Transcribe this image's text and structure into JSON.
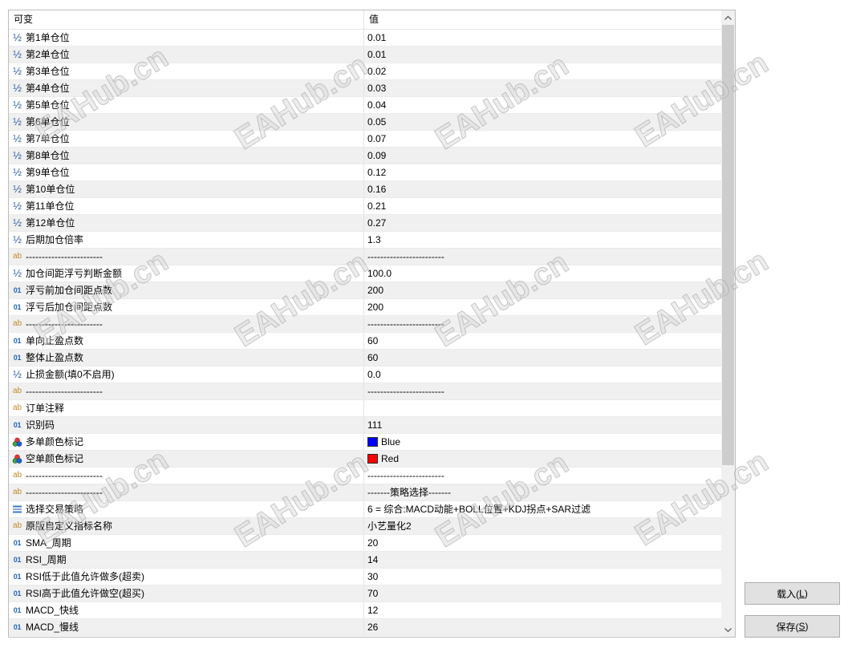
{
  "header": {
    "name_col": "可变",
    "value_col": "值"
  },
  "icons": {
    "double-param-icon": {
      "glyph": "½",
      "color": "#2f5f9f"
    },
    "string-param-icon": {
      "glyph": "ab",
      "color": "#c08a2c"
    },
    "integer-param-icon": {
      "glyph": "01",
      "color": "#2466b4"
    },
    "color-param-icon": {},
    "enum-param-icon": {}
  },
  "rows": [
    {
      "icon": "double-param-icon",
      "name": "第1单仓位",
      "value": "0.01"
    },
    {
      "icon": "double-param-icon",
      "name": "第2单仓位",
      "value": "0.01"
    },
    {
      "icon": "double-param-icon",
      "name": "第3单仓位",
      "value": "0.02"
    },
    {
      "icon": "double-param-icon",
      "name": "第4单仓位",
      "value": "0.03"
    },
    {
      "icon": "double-param-icon",
      "name": "第5单仓位",
      "value": "0.04"
    },
    {
      "icon": "double-param-icon",
      "name": "第6单仓位",
      "value": "0.05"
    },
    {
      "icon": "double-param-icon",
      "name": "第7单仓位",
      "value": "0.07"
    },
    {
      "icon": "double-param-icon",
      "name": "第8单仓位",
      "value": "0.09"
    },
    {
      "icon": "double-param-icon",
      "name": "第9单仓位",
      "value": "0.12"
    },
    {
      "icon": "double-param-icon",
      "name": "第10单仓位",
      "value": "0.16"
    },
    {
      "icon": "double-param-icon",
      "name": "第11单仓位",
      "value": "0.21"
    },
    {
      "icon": "double-param-icon",
      "name": "第12单仓位",
      "value": "0.27"
    },
    {
      "icon": "double-param-icon",
      "name": "后期加仓倍率",
      "value": "1.3"
    },
    {
      "icon": "string-param-icon",
      "name": "------------------------",
      "value": "------------------------"
    },
    {
      "icon": "double-param-icon",
      "name": "加仓间距浮亏判断金额",
      "value": "100.0"
    },
    {
      "icon": "integer-param-icon",
      "name": "浮亏前加仓间距点数",
      "value": "200"
    },
    {
      "icon": "integer-param-icon",
      "name": "浮亏后加仓间距点数",
      "value": "200"
    },
    {
      "icon": "string-param-icon",
      "name": "------------------------",
      "value": "------------------------"
    },
    {
      "icon": "integer-param-icon",
      "name": "单向止盈点数",
      "value": "60"
    },
    {
      "icon": "integer-param-icon",
      "name": "整体止盈点数",
      "value": "60"
    },
    {
      "icon": "double-param-icon",
      "name": "止损金额(填0不启用)",
      "value": "0.0"
    },
    {
      "icon": "string-param-icon",
      "name": "------------------------",
      "value": "------------------------"
    },
    {
      "icon": "string-param-icon",
      "name": "订单注释",
      "value": ""
    },
    {
      "icon": "integer-param-icon",
      "name": "识别码",
      "value": "111"
    },
    {
      "icon": "color-param-icon",
      "name": "多单颜色标记",
      "value": "Blue",
      "swatch": "#0000ff"
    },
    {
      "icon": "color-param-icon",
      "name": "空单颜色标记",
      "value": "Red",
      "swatch": "#ff0000"
    },
    {
      "icon": "string-param-icon",
      "name": "------------------------",
      "value": "------------------------"
    },
    {
      "icon": "string-param-icon",
      "name": "------------------------",
      "value": "-------策略选择-------"
    },
    {
      "icon": "enum-param-icon",
      "name": "选择交易策略",
      "value": "6 = 综合:MACD动能+BOLL位置+KDJ拐点+SAR过滤"
    },
    {
      "icon": "string-param-icon",
      "name": "原版自定义指标名称",
      "value": "小艺量化2"
    },
    {
      "icon": "integer-param-icon",
      "name": "SMA_周期",
      "value": "20"
    },
    {
      "icon": "integer-param-icon",
      "name": "RSI_周期",
      "value": "14"
    },
    {
      "icon": "integer-param-icon",
      "name": "RSI低于此值允许做多(超卖)",
      "value": "30"
    },
    {
      "icon": "integer-param-icon",
      "name": "RSI高于此值允许做空(超买)",
      "value": "70"
    },
    {
      "icon": "integer-param-icon",
      "name": "MACD_快线",
      "value": "12"
    },
    {
      "icon": "integer-param-icon",
      "name": "MACD_慢线",
      "value": "26"
    }
  ],
  "buttons": {
    "load": {
      "before": "载入(",
      "key": "L",
      "after": ")"
    },
    "save": {
      "before": "保存(",
      "key": "S",
      "after": ")"
    }
  },
  "watermark": "EAHub.cn"
}
